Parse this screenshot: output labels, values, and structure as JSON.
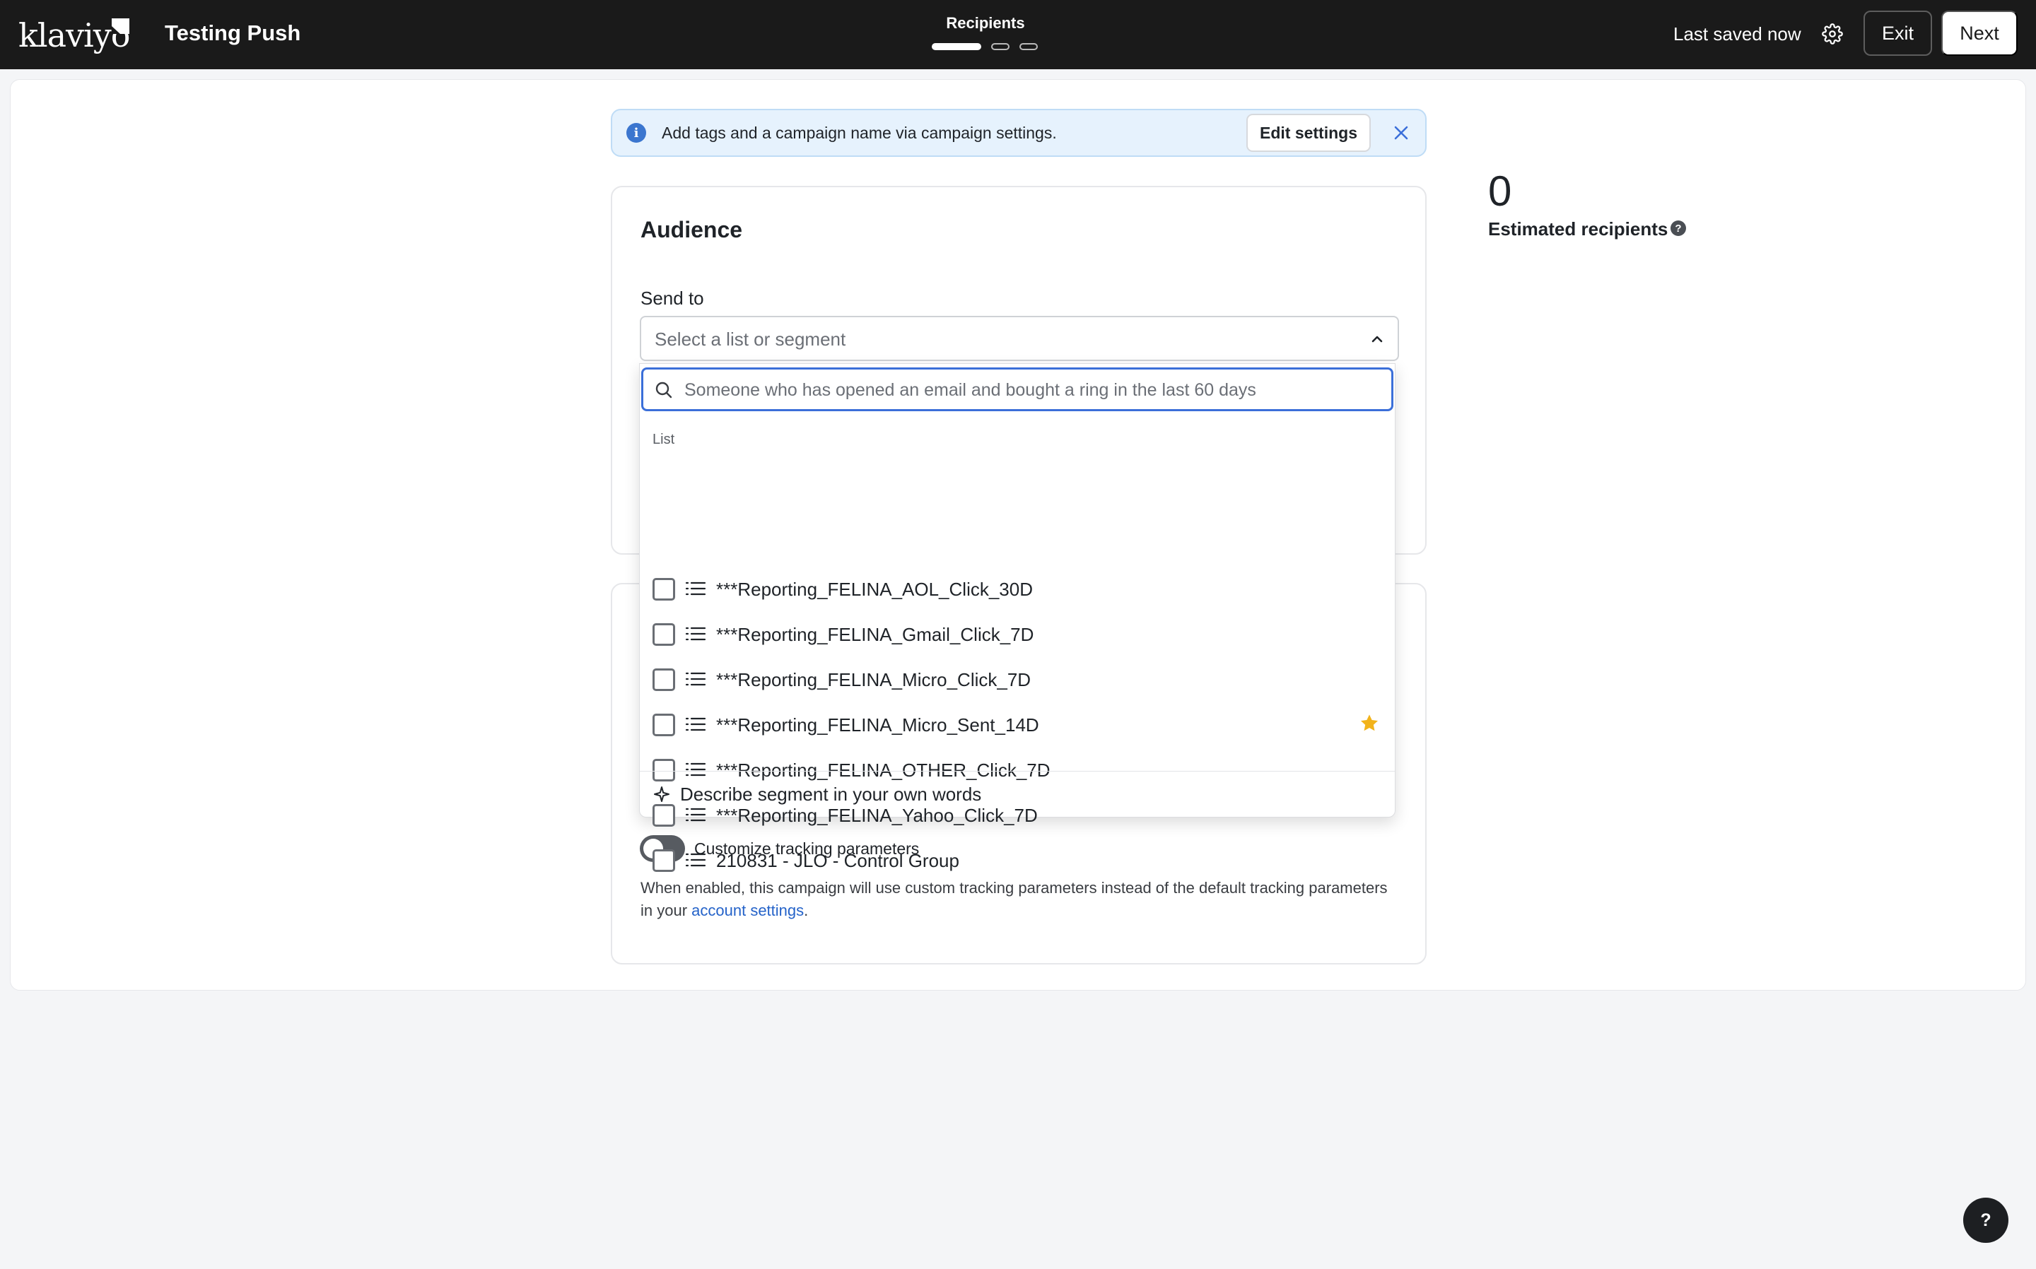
{
  "header": {
    "logo_text": "klaviyo",
    "campaign_name": "Testing Push",
    "step_title": "Recipients",
    "steps_total": 3,
    "step_current": 1,
    "saved_status": "Last saved now",
    "exit_label": "Exit",
    "next_label": "Next",
    "settings_icon": "gear-icon"
  },
  "banner": {
    "icon": "info-icon",
    "text": "Add tags and a campaign name via campaign settings.",
    "edit_label": "Edit settings",
    "close_icon": "close-icon"
  },
  "audience": {
    "title": "Audience",
    "send_to_label": "Send to",
    "select_placeholder": "Select a list or segment",
    "expanded": true
  },
  "dropdown": {
    "search_placeholder": "Someone who has opened an email and bought a ring in the last 60 days",
    "search_value": "",
    "group_label": "List",
    "items": [
      {
        "label": "***Reporting_FELINA_AOL_Click_30D",
        "checked": false,
        "starred": false
      },
      {
        "label": "***Reporting_FELINA_Gmail_Click_7D",
        "checked": false,
        "starred": false
      },
      {
        "label": "***Reporting_FELINA_Micro_Click_7D",
        "checked": false,
        "starred": false
      },
      {
        "label": "***Reporting_FELINA_Micro_Sent_14D",
        "checked": false,
        "starred": true
      },
      {
        "label": "***Reporting_FELINA_OTHER_Click_7D",
        "checked": false,
        "starred": false
      },
      {
        "label": "***Reporting_FELINA_Yahoo_Click_7D",
        "checked": false,
        "starred": false
      },
      {
        "label": "210831 - JLO - Control Group",
        "checked": false,
        "starred": false
      }
    ],
    "describe_label": "Describe segment in your own words"
  },
  "tracking": {
    "toggle_label": "Customize tracking parameters",
    "toggle_on": false,
    "help_prefix": "When enabled, this campaign will use custom tracking parameters instead of the default tracking parameters in your ",
    "help_link": "account settings",
    "help_suffix": "."
  },
  "estimate": {
    "count": "0",
    "label": "Estimated recipients"
  },
  "help_fab": {
    "label": "?"
  },
  "colors": {
    "topbar": "#1a1a1a",
    "accent_blue": "#3b6fd9",
    "link": "#2563c9",
    "banner_bg": "#e6f2fd",
    "star": "#f2b31b"
  }
}
